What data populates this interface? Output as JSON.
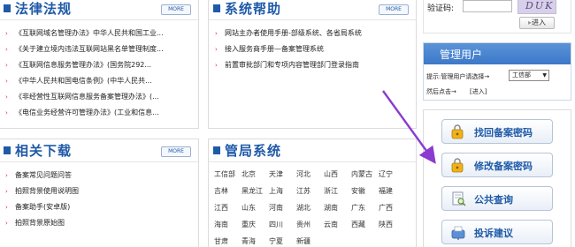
{
  "left_top": {
    "title": "法律法规",
    "more": "MORE",
    "items": [
      "《互联网域名管理办法》中华人民共和国工业...",
      "《关于建立境内违法互联网站黑名单管理制度...",
      "《互联网信息服务管理办法》(国务院292...",
      "《中华人民共和国电信条例》(中华人民共...",
      "《非经营性互联网信息服务备案管理办法》(...",
      "《电信业务经营许可管理办法》(工业和信息..."
    ]
  },
  "mid_top": {
    "title": "系统帮助",
    "more": "MORE",
    "items": [
      "网站主办者使用手册-部级系统、各省局系统",
      "接入服务商手册—备案管理系统",
      "前置审批部门和专项内容管理部门登录指南"
    ]
  },
  "left_bottom": {
    "title": "相关下载",
    "more": "MORE",
    "items": [
      "备案常见问题问答",
      "拍照背景使用说明图",
      "备案助手(安卓版)",
      "拍照背景原始图"
    ]
  },
  "mid_bottom": {
    "title": "管局系统",
    "rows": [
      [
        "工信部",
        "北京",
        "天津",
        "河北",
        "山西",
        "内蒙古",
        "辽宁"
      ],
      [
        "吉林",
        "黑龙江",
        "上海",
        "江苏",
        "浙江",
        "安徽",
        "福建"
      ],
      [
        "江西",
        "山东",
        "河南",
        "湖北",
        "湖南",
        "广东",
        "广西"
      ],
      [
        "海南",
        "重庆",
        "四川",
        "贵州",
        "云南",
        "西藏",
        "陕西"
      ],
      [
        "甘肃",
        "青海",
        "宁夏",
        "新疆"
      ]
    ]
  },
  "login": {
    "captcha_label": "验证码:",
    "captcha_text": "DUK",
    "enter_label": "进入"
  },
  "admin": {
    "title": "管理用户",
    "line1": "提示:管理用户请选择→",
    "select_value": "工信部",
    "line2": "然后点击→",
    "enter_link": "[进入]"
  },
  "buttons": [
    {
      "label": "找回备案密码",
      "icon": "lock-icon"
    },
    {
      "label": "修改备案密码",
      "icon": "lock-icon"
    },
    {
      "label": "公共查询",
      "icon": "search-doc-icon"
    },
    {
      "label": "投诉建议",
      "icon": "mailbox-icon"
    }
  ],
  "colors": {
    "brand_blue": "#1f5aa8",
    "admin_header": "#3c78c8",
    "bullet_red": "#d12a1a",
    "arrow_purple": "#8a3bd0"
  }
}
